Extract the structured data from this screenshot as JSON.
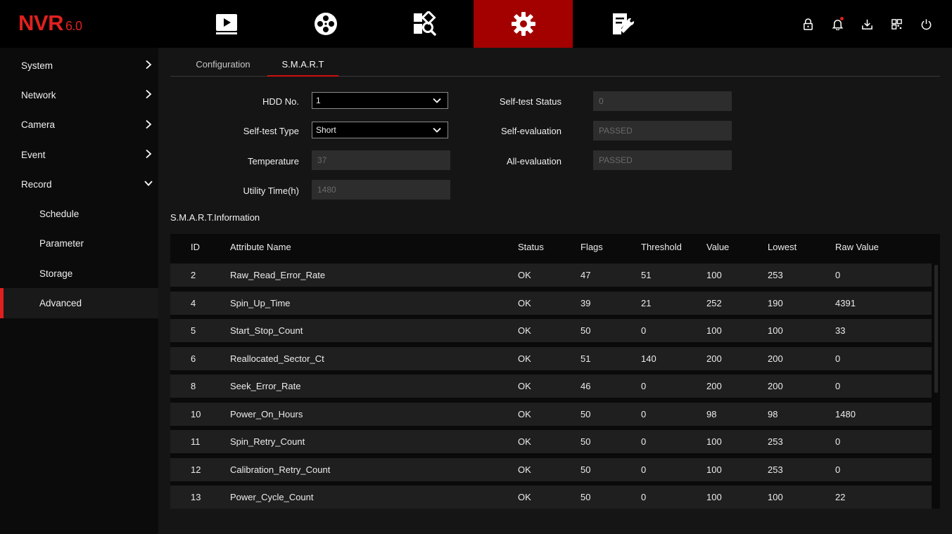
{
  "logo": {
    "brand": "NVR",
    "version": "6.0"
  },
  "top_nav": [
    {
      "name": "live-view",
      "icon": "play-icon",
      "active": false
    },
    {
      "name": "playback",
      "icon": "film-reel-icon",
      "active": false
    },
    {
      "name": "search",
      "icon": "search-grid-icon",
      "active": false
    },
    {
      "name": "settings",
      "icon": "gear-icon",
      "active": true
    },
    {
      "name": "maintenance",
      "icon": "document-wrench-icon",
      "active": false
    }
  ],
  "top_right_icons": [
    "lock-icon",
    "bell-icon",
    "download-icon",
    "qr-code-icon",
    "power-icon"
  ],
  "colors": {
    "accent": "#e0201f",
    "active_nav_bg": "#a30000"
  },
  "sidebar": {
    "items": [
      {
        "label": "System",
        "expandable": true,
        "expanded": false
      },
      {
        "label": "Network",
        "expandable": true,
        "expanded": false
      },
      {
        "label": "Camera",
        "expandable": true,
        "expanded": false
      },
      {
        "label": "Event",
        "expandable": true,
        "expanded": false
      },
      {
        "label": "Record",
        "expandable": true,
        "expanded": true
      },
      {
        "label": "Schedule",
        "sub": true
      },
      {
        "label": "Parameter",
        "sub": true
      },
      {
        "label": "Storage",
        "sub": true
      },
      {
        "label": "Advanced",
        "sub": true,
        "active": true
      }
    ]
  },
  "tabs": [
    {
      "label": "Configuration",
      "active": false
    },
    {
      "label": "S.M.A.R.T",
      "active": true
    }
  ],
  "form": {
    "hdd_no": {
      "label": "HDD No.",
      "value": "1"
    },
    "selftest_type": {
      "label": "Self-test Type",
      "value": "Short"
    },
    "temperature": {
      "label": "Temperature",
      "value": "37"
    },
    "utility_time": {
      "label": "Utility Time(h)",
      "value": "1480"
    },
    "selftest_status": {
      "label": "Self-test Status",
      "value": "0"
    },
    "self_evaluation": {
      "label": "Self-evaluation",
      "value": "PASSED"
    },
    "all_evaluation": {
      "label": "All-evaluation",
      "value": "PASSED"
    }
  },
  "smart_info": {
    "title": "S.M.A.R.T.Information",
    "columns": [
      "ID",
      "Attribute Name",
      "Status",
      "Flags",
      "Threshold",
      "Value",
      "Lowest",
      "Raw Value"
    ],
    "rows": [
      [
        "2",
        "Raw_Read_Error_Rate",
        "OK",
        "47",
        "51",
        "100",
        "253",
        "0"
      ],
      [
        "4",
        "Spin_Up_Time",
        "OK",
        "39",
        "21",
        "252",
        "190",
        "4391"
      ],
      [
        "5",
        "Start_Stop_Count",
        "OK",
        "50",
        "0",
        "100",
        "100",
        "33"
      ],
      [
        "6",
        "Reallocated_Sector_Ct",
        "OK",
        "51",
        "140",
        "200",
        "200",
        "0"
      ],
      [
        "8",
        "Seek_Error_Rate",
        "OK",
        "46",
        "0",
        "200",
        "200",
        "0"
      ],
      [
        "10",
        "Power_On_Hours",
        "OK",
        "50",
        "0",
        "98",
        "98",
        "1480"
      ],
      [
        "11",
        "Spin_Retry_Count",
        "OK",
        "50",
        "0",
        "100",
        "253",
        "0"
      ],
      [
        "12",
        "Calibration_Retry_Count",
        "OK",
        "50",
        "0",
        "100",
        "253",
        "0"
      ],
      [
        "13",
        "Power_Cycle_Count",
        "OK",
        "50",
        "0",
        "100",
        "100",
        "22"
      ]
    ]
  }
}
